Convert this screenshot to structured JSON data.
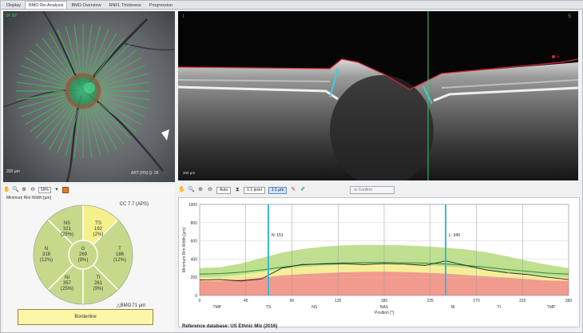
{
  "tabs": [
    "Display",
    "BMO Re-Analysis",
    "BMO Overview",
    "RNFL Thickness",
    "Progression"
  ],
  "active_tab": 1,
  "fundus": {
    "corner_label": "IR 30°",
    "scale_label": "200 µm",
    "info_label": "ART [HS] Q: 26"
  },
  "left_toolbar": {
    "zoom_value": "59%"
  },
  "bmo_panel": {
    "title": "Minimum Rim Width [µm]",
    "cc_label": "CC 7.7 (APS)",
    "sectors": {
      "NS": {
        "code": "NS",
        "value": "321",
        "pct": "(25%)"
      },
      "TS": {
        "code": "TS",
        "value": "192",
        "pct": "(2%)"
      },
      "N": {
        "code": "N",
        "value": "318",
        "pct": "(12%)"
      },
      "G": {
        "code": "G",
        "value": "269",
        "pct": "(9%)"
      },
      "T": {
        "code": "T",
        "value": "186",
        "pct": "(12%)"
      },
      "NI": {
        "code": "NI",
        "value": "357",
        "pct": "(25%)"
      },
      "TI": {
        "code": "TI",
        "value": "261",
        "pct": "(9%)"
      }
    },
    "bmo_area_symbol": "△BMO",
    "bmo_area_value": "71 µm",
    "classification": "Borderline"
  },
  "bscan": {
    "label_left": "I",
    "label_right": "S",
    "scale_label": "200 µm",
    "corner_tag": "M"
  },
  "right_toolbar": {
    "zoom_combo": "Auto",
    "btn_1pixel": "1:1 pixel",
    "btn_1um": "1:1 µm",
    "confirm_label": "Confirm"
  },
  "chart_data": {
    "type": "area",
    "ylabel": "Minimum Rim Width [µm]",
    "xlabel": "Position [°]",
    "xlim": [
      0,
      360
    ],
    "ylim": [
      0,
      1000
    ],
    "y_ticks": [
      "0",
      "200",
      "400",
      "600",
      "800",
      "1000"
    ],
    "x_ticks": [
      "0",
      "45",
      "90",
      "135",
      "180",
      "225",
      "270",
      "315",
      "360"
    ],
    "sector_labels": [
      {
        "label": "TMP",
        "x": 17
      },
      {
        "label": "TS",
        "x": 67
      },
      {
        "label": "NS",
        "x": 112
      },
      {
        "label": "NAS",
        "x": 180
      },
      {
        "label": "NI",
        "x": 247
      },
      {
        "label": "TI",
        "x": 292
      },
      {
        "label": "TMP",
        "x": 343
      }
    ],
    "grid_x": [
      45,
      90,
      135,
      180,
      225,
      270,
      315
    ],
    "markers": [
      {
        "label": "N: 151",
        "x": 67
      },
      {
        "label": "L: 349",
        "x": 240
      }
    ],
    "x": [
      0,
      20,
      40,
      60,
      80,
      100,
      120,
      140,
      160,
      180,
      200,
      220,
      240,
      260,
      280,
      300,
      320,
      340,
      360
    ],
    "bands": {
      "red_upper": [
        160,
        160,
        175,
        195,
        220,
        235,
        245,
        255,
        260,
        262,
        258,
        250,
        240,
        225,
        210,
        195,
        180,
        165,
        160
      ],
      "yellow_upper": [
        200,
        205,
        225,
        255,
        290,
        310,
        325,
        335,
        340,
        342,
        338,
        330,
        318,
        300,
        280,
        255,
        230,
        210,
        200
      ],
      "green_upper": [
        300,
        310,
        350,
        410,
        470,
        510,
        535,
        550,
        555,
        555,
        550,
        540,
        525,
        505,
        475,
        430,
        380,
        335,
        300
      ]
    },
    "series": [
      {
        "name": "",
        "values": [
          235,
          240,
          255,
          280,
          310,
          335,
          350,
          358,
          362,
          363,
          360,
          355,
          345,
          330,
          310,
          285,
          265,
          245,
          235
        ]
      },
      {
        "name": "",
        "values": [
          170,
          175,
          160,
          180,
          300,
          340,
          345,
          350,
          340,
          350,
          345,
          330,
          380,
          330,
          280,
          250,
          230,
          200,
          175
        ]
      }
    ],
    "reference_db": "Reference database: US Ethnic Mix (2016)"
  }
}
